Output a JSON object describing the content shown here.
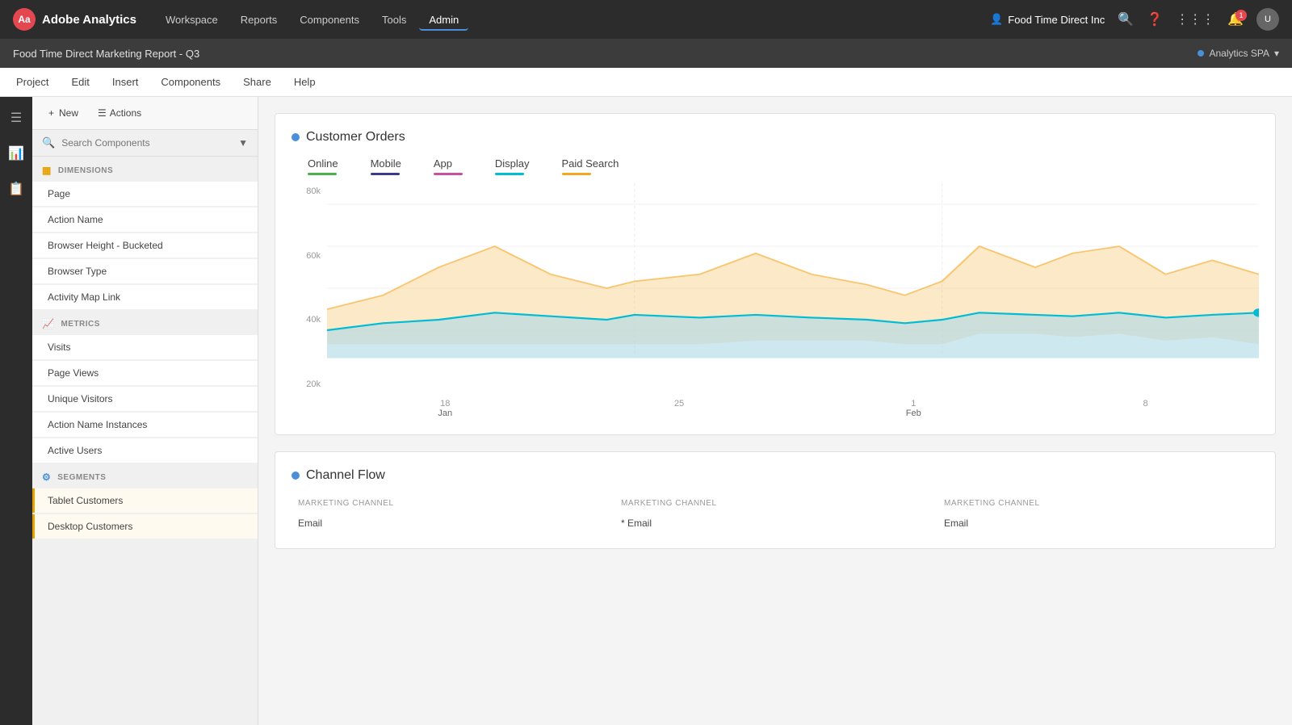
{
  "app": {
    "name": "Adobe Analytics",
    "logo_text": "Aa"
  },
  "top_nav": {
    "links": [
      "Workspace",
      "Reports",
      "Components",
      "Tools",
      "Admin"
    ],
    "active_link": "Admin",
    "company": "Food Time Direct Inc",
    "company_icon": "👤",
    "icons": [
      "🔍",
      "❓",
      "⋮⋮⋮",
      "🔔",
      "👤"
    ],
    "notification_count": "1"
  },
  "second_nav": {
    "project_title": "Food Time Direct Marketing Report - Q3",
    "analytics_label": "Analytics SPA",
    "chevron": "▾"
  },
  "menu_bar": {
    "items": [
      "Project",
      "Edit",
      "Insert",
      "Components",
      "Share",
      "Help"
    ]
  },
  "toolbar": {
    "new_label": "+ New",
    "actions_label": "Actions"
  },
  "search": {
    "placeholder": "Search Components",
    "filter_icon": "▼"
  },
  "dimensions": {
    "section_label": "DIMENSIONS",
    "items": [
      {
        "label": "Page"
      },
      {
        "label": "Action Name"
      },
      {
        "label": "Browser Height - Bucketed"
      },
      {
        "label": "Browser Type"
      },
      {
        "label": "Activity Map Link"
      }
    ]
  },
  "metrics": {
    "section_label": "METRICS",
    "items": [
      {
        "label": "Visits"
      },
      {
        "label": "Page Views"
      },
      {
        "label": "Unique Visitors"
      },
      {
        "label": "Action Name Instances"
      },
      {
        "label": "Active Users"
      }
    ]
  },
  "segments": {
    "section_label": "SEGMENTS",
    "items": [
      {
        "label": "Tablet Customers"
      },
      {
        "label": "Desktop Customers"
      }
    ]
  },
  "chart1": {
    "title": "Customer Orders",
    "title_dot_color": "#4a90d9",
    "legend": [
      {
        "label": "Online",
        "color": "#4caf50"
      },
      {
        "label": "Mobile",
        "color": "#3a3a8c"
      },
      {
        "label": "App",
        "color": "#c850a0"
      },
      {
        "label": "Display",
        "color": "#00bcd4"
      },
      {
        "label": "Paid Search",
        "color": "#f5a623"
      }
    ],
    "y_labels": [
      "80k",
      "60k",
      "40k",
      "20k"
    ],
    "x_labels": [
      "18",
      "25",
      "1",
      "8"
    ],
    "x_sub_labels": [
      "Jan",
      "",
      "Feb",
      ""
    ]
  },
  "chart2": {
    "title": "Channel Flow",
    "title_dot_color": "#4a90d9",
    "table_headers": [
      "MARKETING CHANNEL",
      "MARKETING CHANNEL",
      "MARKETING CHANNEL"
    ],
    "rows": [
      {
        "col1": "Email",
        "col2": "* Email",
        "col3": "Email"
      }
    ]
  },
  "icon_sidebar": {
    "items": [
      "☰",
      "📊",
      "📋"
    ]
  }
}
